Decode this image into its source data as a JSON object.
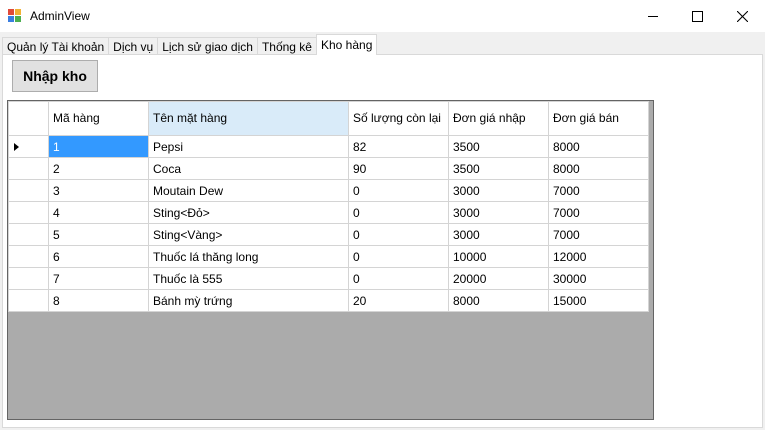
{
  "window": {
    "title": "AdminView"
  },
  "tabs": [
    "Quản lý Tài khoản",
    "Dịch vụ",
    "Lịch sử giao dịch",
    "Thống kê",
    "Kho hàng"
  ],
  "active_tab": "Kho hàng",
  "toolbar": {
    "import_label": "Nhập kho"
  },
  "grid": {
    "columns": [
      "Mã hàng",
      "Tên mặt hàng",
      "Số lượng còn lại",
      "Đơn giá nhập",
      "Đơn giá bán"
    ],
    "rows": [
      [
        "1",
        "Pepsi",
        "82",
        "3500",
        "8000"
      ],
      [
        "2",
        "Coca",
        "90",
        "3500",
        "8000"
      ],
      [
        "3",
        "Moutain Dew",
        "0",
        "3000",
        "7000"
      ],
      [
        "4",
        "Sting<Đỏ>",
        "0",
        "3000",
        "7000"
      ],
      [
        "5",
        "Sting<Vàng>",
        "0",
        "3000",
        "7000"
      ],
      [
        "6",
        "Thuốc lá thăng long",
        "0",
        "10000",
        "12000"
      ],
      [
        "7",
        "Thuốc là 555",
        "0",
        "20000",
        "30000"
      ],
      [
        "8",
        "Bánh mỳ trứng",
        "20",
        "8000",
        "15000"
      ]
    ]
  },
  "colors": {
    "selection": "#3399ff",
    "header_highlight": "#d9ebf9",
    "grid_background": "#ababab"
  }
}
